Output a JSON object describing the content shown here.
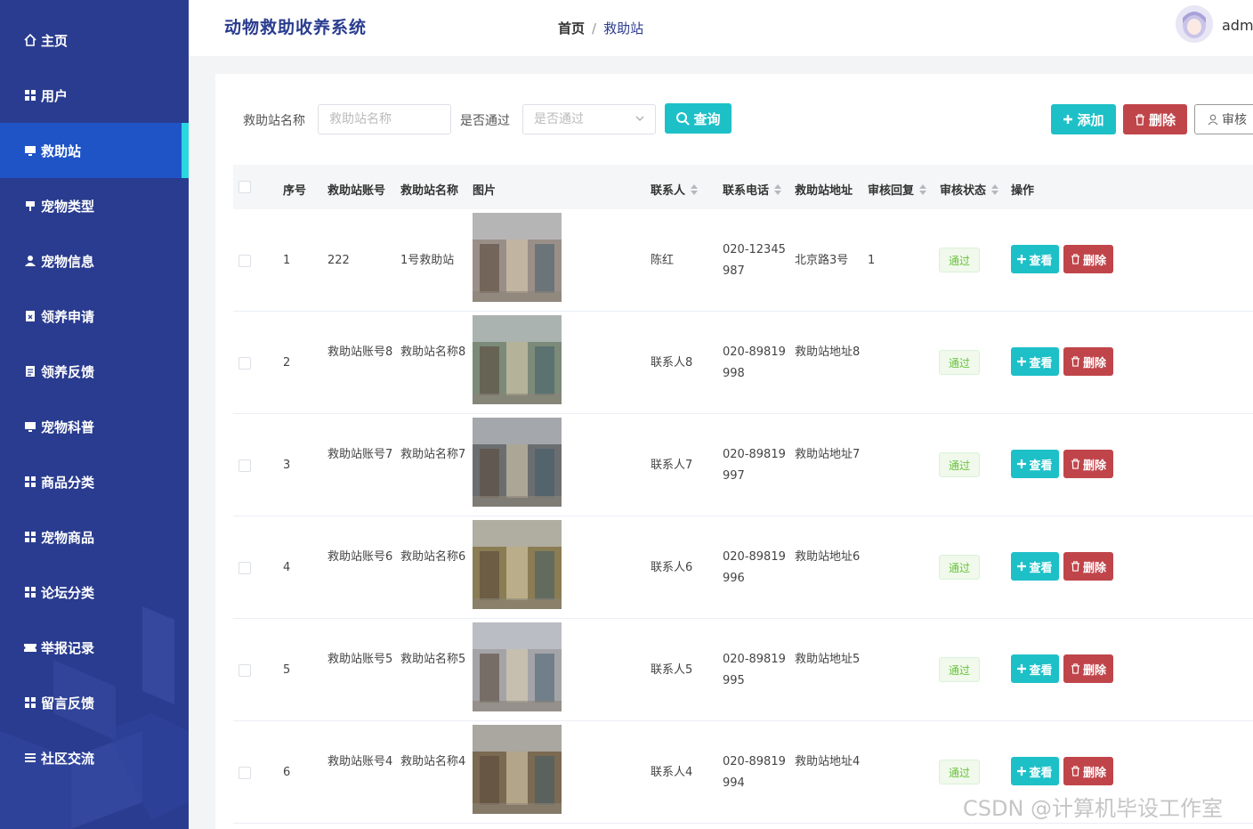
{
  "app": {
    "title": "动物救助收养系统",
    "username": "adm"
  },
  "breadcrumb": {
    "home": "首页",
    "separator": "/",
    "current": "救助站"
  },
  "sidebar": {
    "items": [
      {
        "label": "主页",
        "icon": "home-icon",
        "active": false
      },
      {
        "label": "用户",
        "icon": "grid-icon",
        "active": false
      },
      {
        "label": "救助站",
        "icon": "monitor-icon",
        "active": true
      },
      {
        "label": "宠物类型",
        "icon": "sign-icon",
        "active": false
      },
      {
        "label": "宠物信息",
        "icon": "user-icon",
        "active": false
      },
      {
        "label": "领养申请",
        "icon": "document-x-icon",
        "active": false
      },
      {
        "label": "领养反馈",
        "icon": "clipboard-icon",
        "active": false
      },
      {
        "label": "宠物科普",
        "icon": "monitor-icon",
        "active": false
      },
      {
        "label": "商品分类",
        "icon": "grid-icon",
        "active": false
      },
      {
        "label": "宠物商品",
        "icon": "grid-icon",
        "active": false
      },
      {
        "label": "论坛分类",
        "icon": "grid-icon",
        "active": false
      },
      {
        "label": "举报记录",
        "icon": "ticket-icon",
        "active": false
      },
      {
        "label": "留言反馈",
        "icon": "grid-icon",
        "active": false
      },
      {
        "label": "社区交流",
        "icon": "list-icon",
        "active": false
      }
    ]
  },
  "search": {
    "name_label": "救助站名称",
    "name_placeholder": "救助站名称",
    "pass_label": "是否通过",
    "pass_placeholder": "是否通过",
    "query_label": "查询"
  },
  "actions": {
    "add_label": "添加",
    "delete_label": "删除",
    "audit_label": "审核"
  },
  "table": {
    "columns": {
      "index": "序号",
      "account": "救助站账号",
      "name": "救助站名称",
      "image": "图片",
      "contact": "联系人",
      "phone": "联系电话",
      "address": "救助站地址",
      "reply": "审核回复",
      "status": "审核状态",
      "ops": "操作"
    },
    "view_label": "查看",
    "delete_label": "删除",
    "rows": [
      {
        "index": "1",
        "account": "222",
        "name": "1号救助站",
        "contact": "陈红",
        "phone": "020-12345987",
        "address": "北京路3号",
        "reply": "1",
        "status": "通过",
        "thumb_color": "#9a8f88"
      },
      {
        "index": "2",
        "account": "救助站账号8",
        "name": "救助站名称8",
        "contact": "联系人8",
        "phone": "020-89819998",
        "address": "救助站地址8",
        "reply": "",
        "status": "通过",
        "thumb_color": "#7c8a79"
      },
      {
        "index": "3",
        "account": "救助站账号7",
        "name": "救助站名称7",
        "contact": "联系人7",
        "phone": "020-89819997",
        "address": "救助站地址7",
        "reply": "",
        "status": "通过",
        "thumb_color": "#6b6e70"
      },
      {
        "index": "4",
        "account": "救助站账号6",
        "name": "救助站名称6",
        "contact": "联系人6",
        "phone": "020-89819996",
        "address": "救助站地址6",
        "reply": "",
        "status": "通过",
        "thumb_color": "#8a7c53"
      },
      {
        "index": "5",
        "account": "救助站账号5",
        "name": "救助站名称5",
        "contact": "联系人5",
        "phone": "020-89819995",
        "address": "救助站地址5",
        "reply": "",
        "status": "通过",
        "thumb_color": "#a4a4a8"
      },
      {
        "index": "6",
        "account": "救助站账号4",
        "name": "救助站名称4",
        "contact": "联系人4",
        "phone": "020-89819994",
        "address": "救助站地址4",
        "reply": "",
        "status": "通过",
        "thumb_color": "#7a6a52"
      }
    ]
  },
  "watermark": "CSDN @计算机毕设工作室"
}
